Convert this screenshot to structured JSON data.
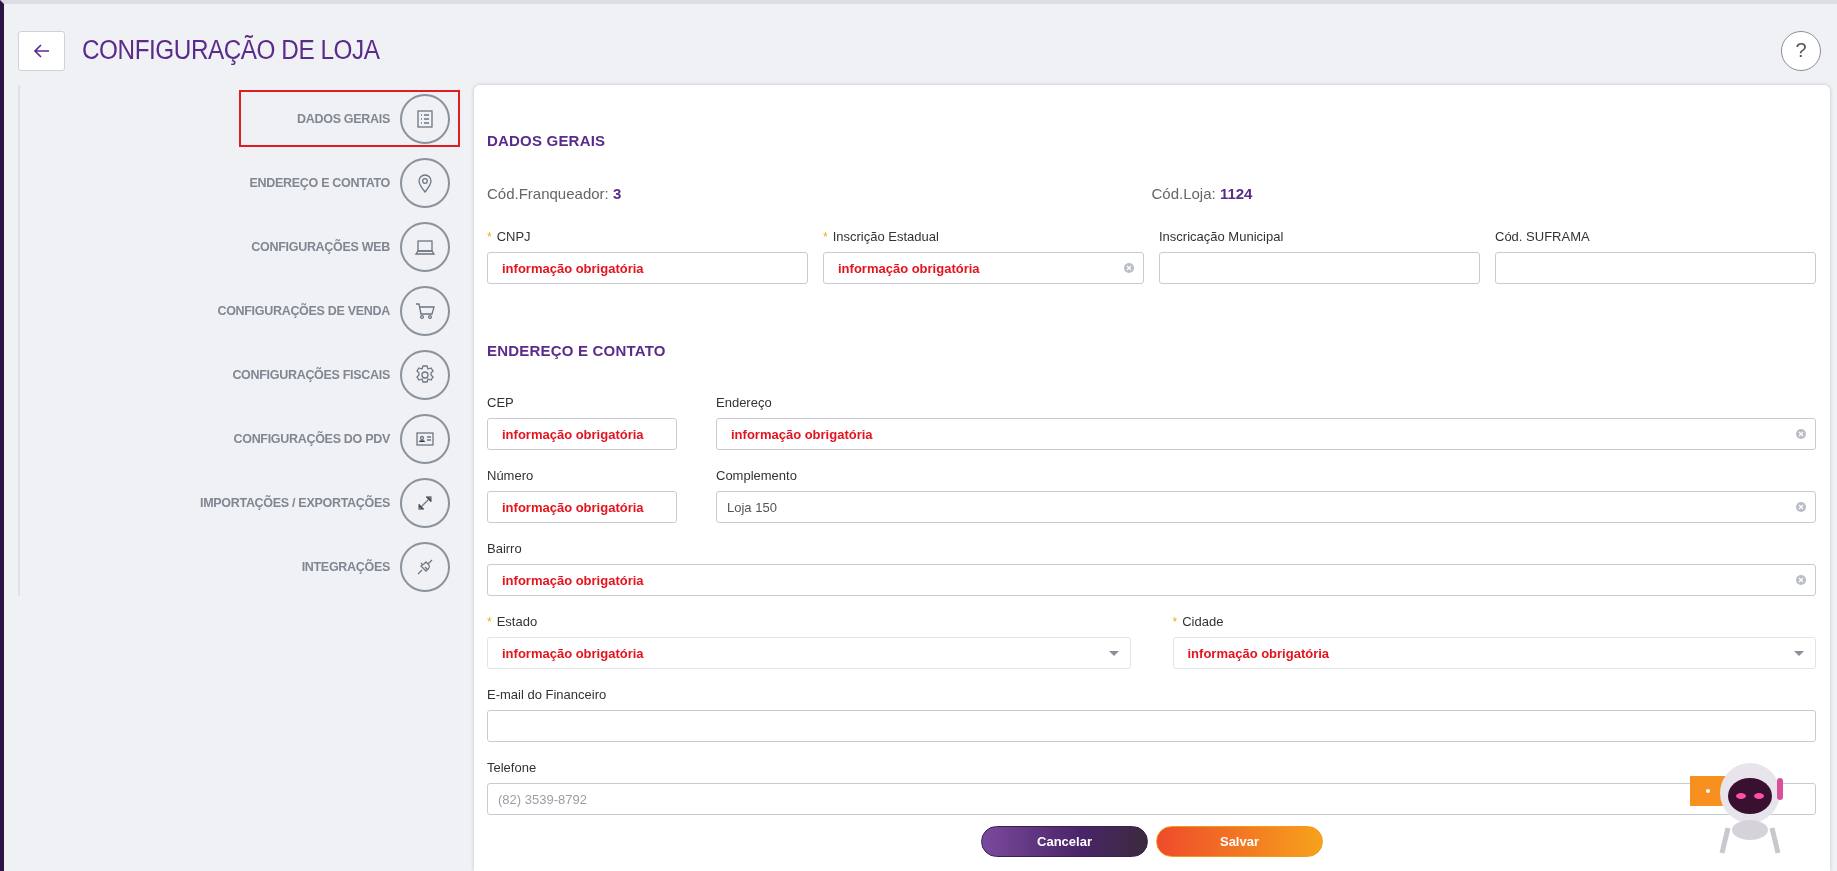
{
  "header": {
    "title": "CONFIGURAÇÃO DE LOJA",
    "help": "?"
  },
  "sidebar": {
    "items": [
      {
        "label": "DADOS GERAIS",
        "selected": true
      },
      {
        "label": "ENDEREÇO E CONTATO",
        "selected": false
      },
      {
        "label": "CONFIGURAÇÕES WEB",
        "selected": false
      },
      {
        "label": "CONFIGURAÇÕES DE VENDA",
        "selected": false
      },
      {
        "label": "CONFIGURAÇÕES FISCAIS",
        "selected": false
      },
      {
        "label": "CONFIGURAÇÕES DO PDV",
        "selected": false
      },
      {
        "label": "IMPORTAÇÕES / EXPORTAÇÕES",
        "selected": false
      },
      {
        "label": "INTEGRAÇÕES",
        "selected": false
      }
    ]
  },
  "sections": [
    {
      "title": "DADOS GERAIS",
      "info": [
        {
          "label": "Cód.Franqueador:",
          "value": "3"
        },
        {
          "label": "Cód.Loja:",
          "value": "1124"
        }
      ],
      "rows": [
        {
          "fields": [
            {
              "label": "CNPJ",
              "required_mark": "*",
              "kind": "text",
              "error": "informação obrigatória"
            },
            {
              "label": "Inscrição Estadual",
              "required_mark": "*",
              "kind": "text",
              "error": "informação obrigatória",
              "clear_button": true
            },
            {
              "label": "Inscricação Municipal",
              "kind": "text"
            },
            {
              "label": "Cód. SUFRAMA",
              "kind": "text"
            }
          ]
        }
      ]
    },
    {
      "title": "ENDEREÇO E CONTATO",
      "rows": [
        {
          "fields": [
            {
              "label": "CEP",
              "kind": "text",
              "error": "informação obrigatória"
            },
            {
              "label": "Endereço",
              "kind": "text",
              "error": "informação obrigatória",
              "clear_button": true
            }
          ]
        },
        {
          "fields": [
            {
              "label": "Número",
              "kind": "text",
              "error": "informação obrigatória"
            },
            {
              "label": "Complemento",
              "kind": "text",
              "value": "Loja 150",
              "clear_button": true
            }
          ]
        },
        {
          "fields": [
            {
              "label": "Bairro",
              "kind": "text",
              "error": "informação obrigatória",
              "clear_button": true
            }
          ]
        },
        {
          "fields": [
            {
              "label": "Estado",
              "required_mark": "*",
              "kind": "select",
              "error": "informação obrigatória"
            },
            {
              "label": "Cidade",
              "required_mark": "*",
              "kind": "select",
              "error": "informação obrigatória"
            }
          ]
        },
        {
          "fields": [
            {
              "label": "E-mail do Financeiro",
              "kind": "text"
            }
          ]
        },
        {
          "fields": [
            {
              "label": "Telefone",
              "kind": "text",
              "placeholder": "(82) 3539-8792"
            }
          ]
        }
      ]
    }
  ],
  "actions": [
    {
      "label": "Cancelar",
      "kind": "secondary"
    },
    {
      "label": "Salvar",
      "kind": "primary"
    }
  ]
}
